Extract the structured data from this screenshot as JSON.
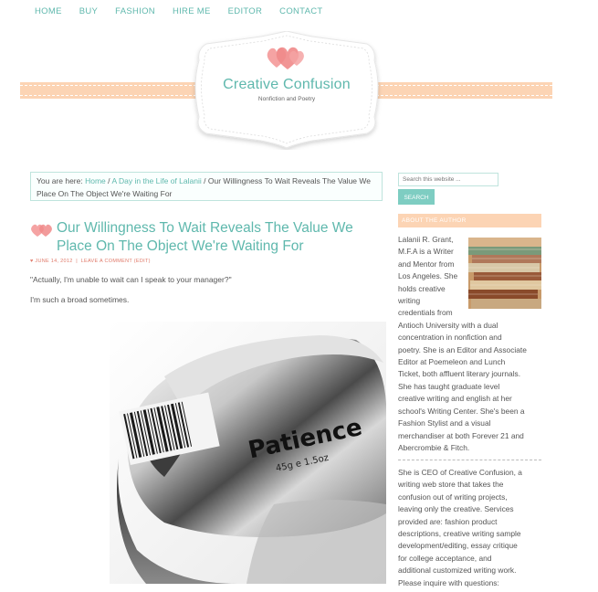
{
  "nav": [
    "HOME",
    "BUY",
    "FASHION",
    "HIRE ME",
    "EDITOR",
    "CONTACT"
  ],
  "header": {
    "title": "Creative Confusion",
    "tagline": "Nonfiction and Poetry"
  },
  "breadcrumb": {
    "prefix": "You are here:",
    "home": "Home",
    "sep1": "/",
    "category": "A Day in the Life of Lalanii",
    "sep2": "/",
    "current": "Our Willingness To Wait Reveals The Value We Place On The Object We're Waiting For"
  },
  "post": {
    "title": "Our Willingness To Wait Reveals The Value We Place On The Object We're Waiting For",
    "date": "JUNE 14, 2012",
    "comment": "LEAVE A COMMENT",
    "edit": "(EDIT)",
    "paragraph1": "\"Actually, I'm unable to wait can I speak to your manager?\"",
    "paragraph2": "I'm such a broad sometimes.",
    "image_text_brand": "Patience",
    "image_text_weight": "45g e 1.5oz"
  },
  "sidebar": {
    "search_placeholder": "Search this website ...",
    "search_button": "SEARCH",
    "about_heading": "ABOUT THE AUTHOR",
    "bio_lines": [
      "Lalanii R. Grant,",
      "M.F.A is a Writer",
      "and Mentor from",
      "Los Angeles. She",
      "holds creative",
      "writing",
      "credentials from",
      "Antioch University with a dual",
      "concentration in nonfiction and",
      "poetry. She is an Editor and Associate",
      "Editor at Poemeleon and Lunch",
      "Ticket, both affluent literary journals.",
      "She has taught graduate level",
      "creative writing and english at her",
      "school's Writing Center. She's been a",
      "Fashion Stylist and a visual",
      "merchandiser at both Forever 21 and",
      "Abercrombie & Fitch."
    ],
    "bio2_lines": [
      "She is CEO of Creative Confusion, a",
      "writing web store that takes the",
      "confusion out of writing projects,",
      "leaving only the creative. Services",
      "provided are: fashion product",
      "descriptions, creative writing sample",
      "development/editing, essay critique",
      "for college acceptance, and",
      "additional customized writing work.",
      "Please inquire with questions:"
    ]
  },
  "colors": {
    "accent": "#5fb8ad",
    "peach": "#fcd4b4",
    "heart": "#f08a8a"
  }
}
